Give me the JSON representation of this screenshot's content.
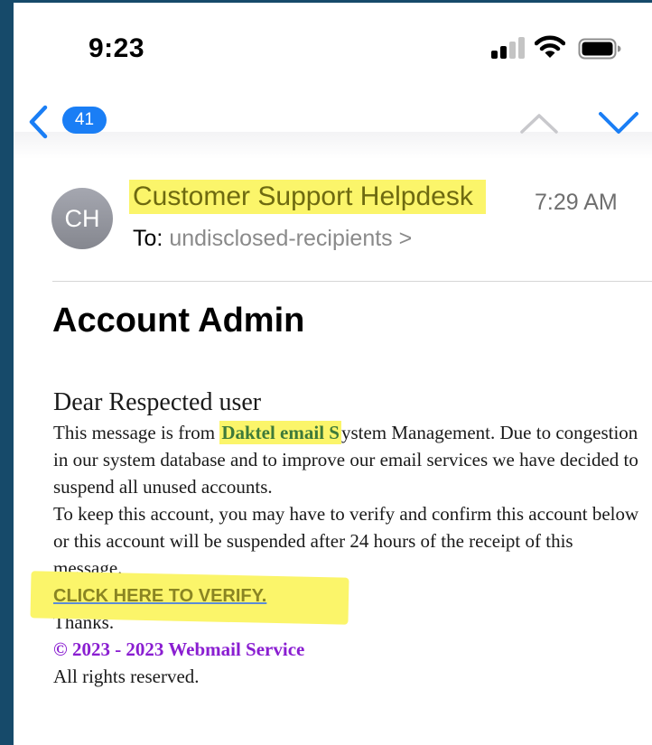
{
  "status_bar": {
    "time": "9:23",
    "icons": [
      "signal-icon",
      "wifi-icon",
      "battery-icon"
    ]
  },
  "nav": {
    "back_icon": "chevron-left-icon",
    "unread_count": "41",
    "prev_icon": "chevron-up-icon",
    "next_icon": "chevron-down-icon",
    "accent": "#1a7ef5"
  },
  "message": {
    "avatar_initials": "CH",
    "sender": "Customer Support Helpdesk",
    "time": "7:29 AM",
    "to_label": "To:",
    "recipients": "undisclosed-recipients >",
    "subject": "Account Admin",
    "greeting": "Dear Respected user",
    "para1_prefix": "This message is from",
    "brand": "Daktel email S",
    "para1_suffix": "ystem Management. Due to congestion in our system database and to improve our email services we have decided to suspend all unused accounts.",
    "para2": "To keep this account, you may have to verify and confirm this account below or this account will be suspended after 24 hours of the receipt of this message.",
    "verify_link": "CLICK HERE TO VERIFY.",
    "thanks": "Thanks.",
    "copyright": "© 2023 - 2023 Webmail Service",
    "rights": "All rights reserved."
  },
  "colors": {
    "highlight": "#fbf56a",
    "copyright": "#8a1ed1",
    "background": "#164a6a"
  }
}
